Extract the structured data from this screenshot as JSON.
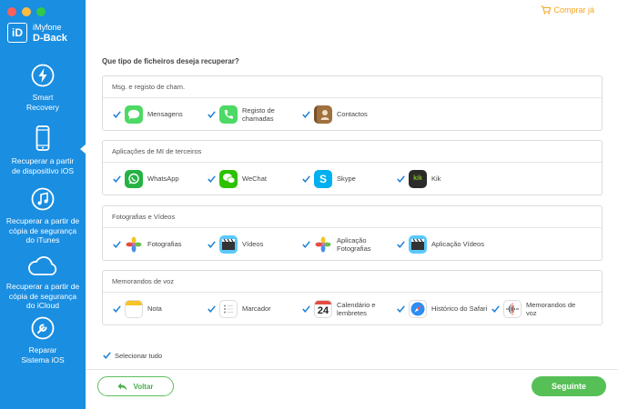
{
  "colors": {
    "sidebar": "#1a8ee1",
    "accent_green": "#56c056",
    "buy_orange": "#f5a623",
    "check_blue": "#1a7fd6"
  },
  "app": {
    "logo_letter": "iD",
    "name_line1": "iMyfone",
    "name_line2": "D-Back"
  },
  "topbar": {
    "buy_label": "Comprar já",
    "buy_icon": "cart-icon"
  },
  "sidebar": {
    "items": [
      {
        "label": "Smart\nRecovery",
        "icon": "lightning-icon"
      },
      {
        "label": "Recuperar a partir\nde dispositivo iOS",
        "icon": "phone-icon",
        "active": true
      },
      {
        "label": "Recuperar a partir de\ncópia de segurança\ndo iTunes",
        "icon": "music-note-icon"
      },
      {
        "label": "Recuperar a partir de\ncópia de segurança\ndo iCloud",
        "icon": "cloud-icon"
      },
      {
        "label": "Reparar\nSistema iOS",
        "icon": "wrench-icon"
      }
    ]
  },
  "main": {
    "question": "Que tipo de ficheiros deseja recuperar?",
    "sections": [
      {
        "title": "Msg. e registo de cham.",
        "options": [
          {
            "label": "Mensagens",
            "icon": "messages-icon",
            "checked": true
          },
          {
            "label": "Registo de\nchamadas",
            "icon": "phone-call-icon",
            "checked": true
          },
          {
            "label": "Contactos",
            "icon": "contacts-icon",
            "checked": true
          }
        ]
      },
      {
        "title": "Aplicações de MI de terceiros",
        "options": [
          {
            "label": "WhatsApp",
            "icon": "whatsapp-icon",
            "checked": true
          },
          {
            "label": "WeChat",
            "icon": "wechat-icon",
            "checked": true
          },
          {
            "label": "Skype",
            "icon": "skype-icon",
            "checked": true
          },
          {
            "label": "Kik",
            "icon": "kik-icon",
            "checked": true
          }
        ]
      },
      {
        "title": "Fotografias e Vídeos",
        "options": [
          {
            "label": "Fotografias",
            "icon": "photos-icon",
            "checked": true
          },
          {
            "label": "Vídeos",
            "icon": "videos-icon",
            "checked": true
          },
          {
            "label": "Aplicação\nFotografias",
            "icon": "app-photos-icon",
            "checked": true
          },
          {
            "label": "Aplicação Vídeos",
            "icon": "app-videos-icon",
            "checked": true
          }
        ]
      },
      {
        "title": "Memorandos de voz",
        "options": [
          {
            "label": "Nota",
            "icon": "notes-icon",
            "checked": true
          },
          {
            "label": "Marcador",
            "icon": "bookmark-icon",
            "checked": true
          },
          {
            "label": "Calendário e\nlembretes",
            "icon": "calendar-icon",
            "calendar_day": "24",
            "checked": true
          },
          {
            "label": "Histórico do Safari",
            "icon": "safari-icon",
            "checked": true
          },
          {
            "label": "Memorandos de\nvoz",
            "icon": "voice-memos-icon",
            "checked": true
          }
        ]
      }
    ],
    "select_all": {
      "label": "Selecionar tudo",
      "checked": true
    }
  },
  "footer": {
    "back_label": "Voltar",
    "next_label": "Seguinte"
  }
}
